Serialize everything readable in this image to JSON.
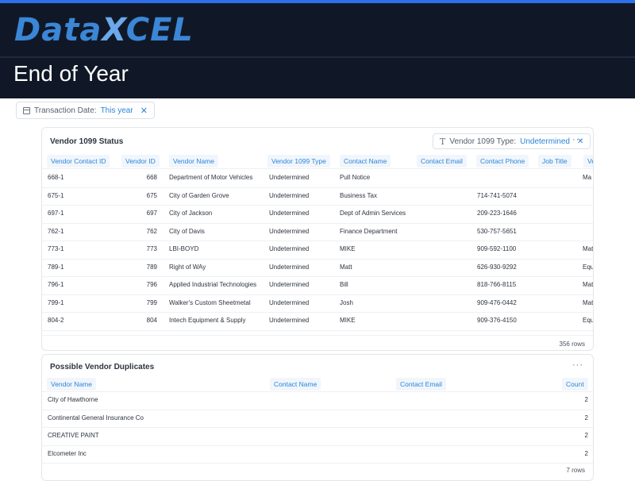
{
  "brand": {
    "logo_prefix": "Data",
    "logo_x": "X",
    "logo_suffix": "CEL"
  },
  "page": {
    "title": "End of Year"
  },
  "filter": {
    "label": "Transaction Date:",
    "value": "This year",
    "icon": "calendar-icon"
  },
  "vendor_status": {
    "title": "Vendor 1099 Status",
    "filter_label": "Vendor 1099 Type:",
    "filter_value": "Undetermined",
    "columns": [
      "Vendor Contact ID",
      "Vendor ID",
      "Vendor Name",
      "Vendor 1099 Type",
      "Contact Name",
      "Contact Email",
      "Contact Phone",
      "Job Title",
      "Ve"
    ],
    "rows": [
      {
        "contact_id": "668-1",
        "vendor_id": "668",
        "name": "Department of Motor Vehicles",
        "type": "Undetermined",
        "contact": "Pull Notice",
        "email": "",
        "phone": "",
        "job": "Ma"
      },
      {
        "contact_id": "675-1",
        "vendor_id": "675",
        "name": "City of Garden Grove",
        "type": "Undetermined",
        "contact": "Business Tax",
        "email": "",
        "phone": "714-741-5074",
        "job": ""
      },
      {
        "contact_id": "697-1",
        "vendor_id": "697",
        "name": "City of Jackson",
        "type": "Undetermined",
        "contact": "Dept of Admin Services",
        "email": "",
        "phone": "209-223-1646",
        "job": ""
      },
      {
        "contact_id": "762-1",
        "vendor_id": "762",
        "name": "City of Davis",
        "type": "Undetermined",
        "contact": "Finance Department",
        "email": "",
        "phone": "530-757-5651",
        "job": ""
      },
      {
        "contact_id": "773-1",
        "vendor_id": "773",
        "name": "LBI-BOYD",
        "type": "Undetermined",
        "contact": "MIKE",
        "email": "",
        "phone": "909-592-1100",
        "job": "Mat"
      },
      {
        "contact_id": "789-1",
        "vendor_id": "789",
        "name": "Right of WAy",
        "type": "Undetermined",
        "contact": "Matt",
        "email": "",
        "phone": "626-930-9292",
        "job": "Equ"
      },
      {
        "contact_id": "796-1",
        "vendor_id": "796",
        "name": "Applied Industrial Technologies",
        "type": "Undetermined",
        "contact": "Bill",
        "email": "",
        "phone": "818-766-8115",
        "job": "Mat"
      },
      {
        "contact_id": "799-1",
        "vendor_id": "799",
        "name": "Walker's Custom Sheetmetal",
        "type": "Undetermined",
        "contact": "Josh",
        "email": "",
        "phone": "909-476-0442",
        "job": "Mat"
      },
      {
        "contact_id": "804-2",
        "vendor_id": "804",
        "name": "Intech Equipment & Supply",
        "type": "Undetermined",
        "contact": "MIKE",
        "email": "",
        "phone": "909-376-4150",
        "job": "Equ"
      }
    ],
    "row_count": "356 rows"
  },
  "duplicates": {
    "title": "Possible Vendor Duplicates",
    "columns": [
      "Vendor Name",
      "Contact Name",
      "Contact Email",
      "Count"
    ],
    "rows": [
      {
        "name": "City of Hawthorne",
        "count": "2"
      },
      {
        "name": "Continental General Insurance Co",
        "count": "2"
      },
      {
        "name": "CREATIVE PAINT",
        "count": "2"
      },
      {
        "name": "Elcometer Inc",
        "count": "2"
      }
    ],
    "row_count": "7 rows"
  },
  "colors": {
    "accent": "#2c85d8",
    "header_bg": "#101827",
    "top_bar": "#2f6fea"
  }
}
